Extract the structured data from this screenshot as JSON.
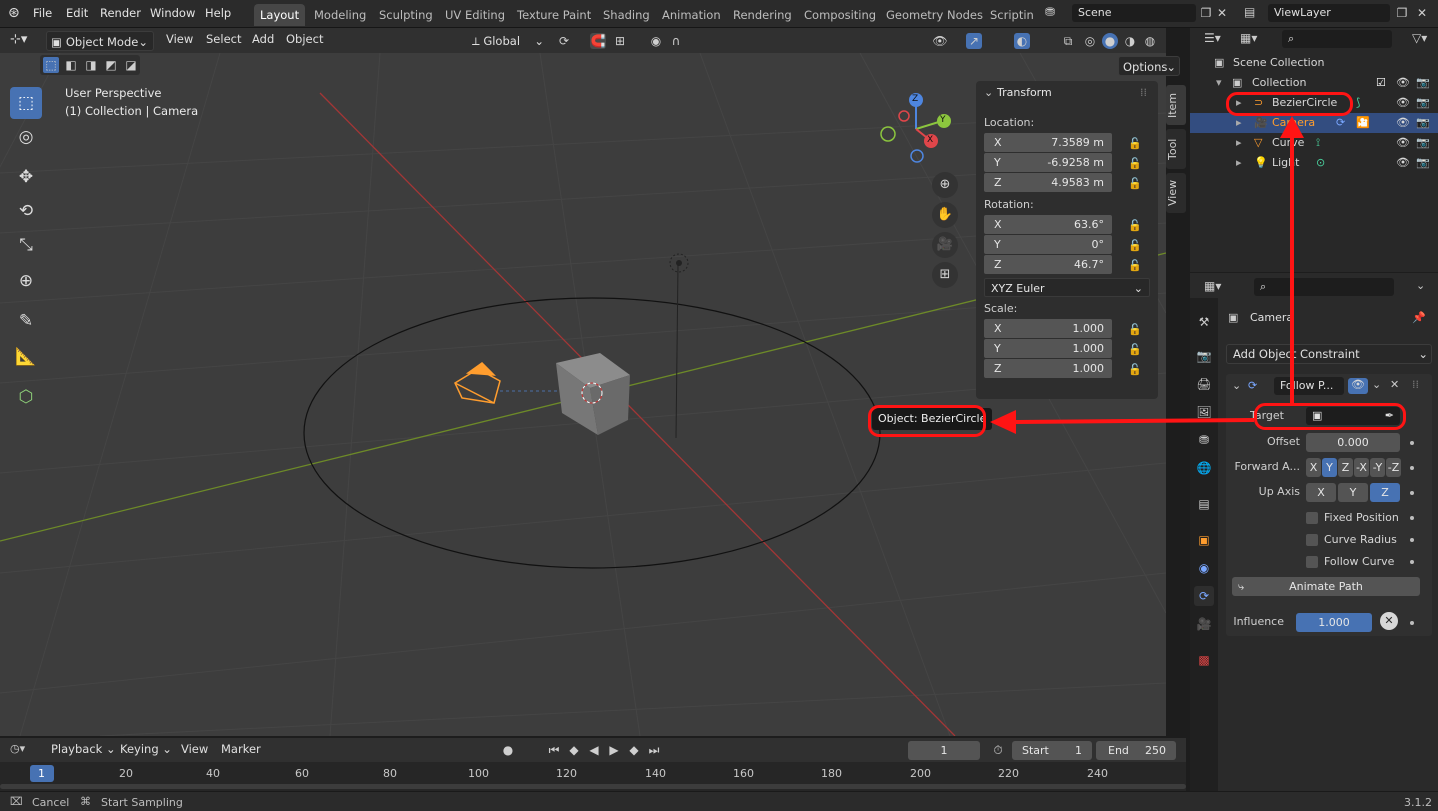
{
  "topbar": {
    "menus": [
      "File",
      "Edit",
      "Render",
      "Window",
      "Help"
    ],
    "workspaces": [
      "Layout",
      "Modeling",
      "Sculpting",
      "UV Editing",
      "Texture Paint",
      "Shading",
      "Animation",
      "Rendering",
      "Compositing",
      "Geometry Nodes",
      "Scripting"
    ],
    "active_workspace": "Layout",
    "scene": "Scene",
    "view_layer": "ViewLayer"
  },
  "viewport_header": {
    "mode": "Object Mode",
    "menus": [
      "View",
      "Select",
      "Add",
      "Object"
    ],
    "transform_orientation": "Global",
    "options": "Options"
  },
  "viewport": {
    "perspective": "User Perspective",
    "collection_info": "(1) Collection | Camera",
    "gizmo_axes": [
      "Z",
      "Y",
      "X"
    ],
    "tooltip": "Object: BezierCircle"
  },
  "npanel": {
    "title": "Transform",
    "tabs": [
      "Item",
      "Tool",
      "View"
    ],
    "location_label": "Location:",
    "location": [
      {
        "axis": "X",
        "value": "7.3589 m"
      },
      {
        "axis": "Y",
        "value": "-6.9258 m"
      },
      {
        "axis": "Z",
        "value": "4.9583 m"
      }
    ],
    "rotation_label": "Rotation:",
    "rotation": [
      {
        "axis": "X",
        "value": "63.6°"
      },
      {
        "axis": "Y",
        "value": "0°"
      },
      {
        "axis": "Z",
        "value": "46.7°"
      }
    ],
    "rotation_mode": "XYZ Euler",
    "scale_label": "Scale:",
    "scale": [
      {
        "axis": "X",
        "value": "1.000"
      },
      {
        "axis": "Y",
        "value": "1.000"
      },
      {
        "axis": "Z",
        "value": "1.000"
      }
    ]
  },
  "outliner": {
    "scene_collection": "Scene Collection",
    "collection": "Collection",
    "items": [
      "BezierCircle",
      "Camera",
      "Curve",
      "Light"
    ],
    "selected": "Camera"
  },
  "properties": {
    "object_name": "Camera",
    "add_constraint": "Add Object Constraint",
    "constraint_name": "Follow P...",
    "target_label": "Target",
    "offset_label": "Offset",
    "offset_value": "0.000",
    "forward_axis_label": "Forward A...",
    "forward_axis_options": [
      "X",
      "Y",
      "Z",
      "-X",
      "-Y",
      "-Z"
    ],
    "forward_axis_selected": "Y",
    "up_axis_label": "Up Axis",
    "up_axis_options": [
      "X",
      "Y",
      "Z"
    ],
    "up_axis_selected": "Z",
    "fixed_position": "Fixed Position",
    "curve_radius": "Curve Radius",
    "follow_curve": "Follow Curve",
    "animate_path": "Animate Path",
    "influence_label": "Influence",
    "influence_value": "1.000"
  },
  "timeline": {
    "menus": [
      "Playback",
      "Keying",
      "View",
      "Marker"
    ],
    "current_frame": "1",
    "start_label": "Start",
    "start_value": "1",
    "end_label": "End",
    "end_value": "250",
    "ticks": [
      "1",
      "20",
      "40",
      "60",
      "80",
      "100",
      "120",
      "140",
      "160",
      "180",
      "200",
      "220",
      "240"
    ]
  },
  "status": {
    "cancel": "Cancel",
    "start_sampling": "Start Sampling",
    "version": "3.1.2"
  },
  "colors": {
    "accent": "#4772b3",
    "annotation": "#ff1414",
    "selected_row": "#334d80"
  }
}
